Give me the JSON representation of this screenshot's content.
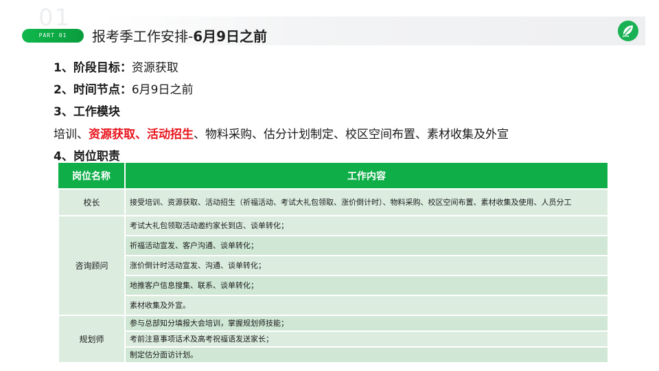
{
  "header": {
    "part_ghost": "01",
    "part_label": "PART 01",
    "title_prefix": "报考季工作安排-",
    "title_bold": "6月9日之前",
    "logo_icon": "leaf-logo",
    "accent_color": "#0fae49"
  },
  "sections": {
    "goal_label": "1、阶段目标：",
    "goal_value": "资源获取",
    "time_label": "2、时间节点：",
    "time_value": "6月9日之前",
    "modules_label": "3、工作模块",
    "modules_line": {
      "part1": "培训、",
      "highlight1": "资源获取",
      "sep1": "、",
      "highlight2": "活动招生",
      "rest": "、物料采购、估分计划制定、校区空间布置、素材收集及外宣"
    },
    "duties_label": "4、岗位职责",
    "highlight_color": "#e8141c"
  },
  "table": {
    "headers": [
      "岗位名称",
      "工作内容"
    ],
    "rows": [
      {
        "role": "校长",
        "tasks": [
          "接受培训、资源获取、活动招生（祈福活动、考试大礼包领取、涨价倒计时）、物料采购、校区空间布置、素材收集及使用、人员分工"
        ]
      },
      {
        "role": "咨询顾问",
        "tasks": [
          "考试大礼包领取活动邀约家长到店、谈单转化；",
          "祈福活动宣发、客户沟通、谈单转化；",
          "涨价倒计时活动宣发、沟通、谈单转化；",
          "地推客户信息搜集、联系、谈单转化；",
          "素材收集及外宣。"
        ]
      },
      {
        "role": "规划师",
        "tasks": [
          "参与总部知分填报大会培训，掌握规划师技能；",
          "考前注意事项话术及高考祝福语发送家长；",
          "制定估分面访计划。"
        ]
      }
    ]
  }
}
